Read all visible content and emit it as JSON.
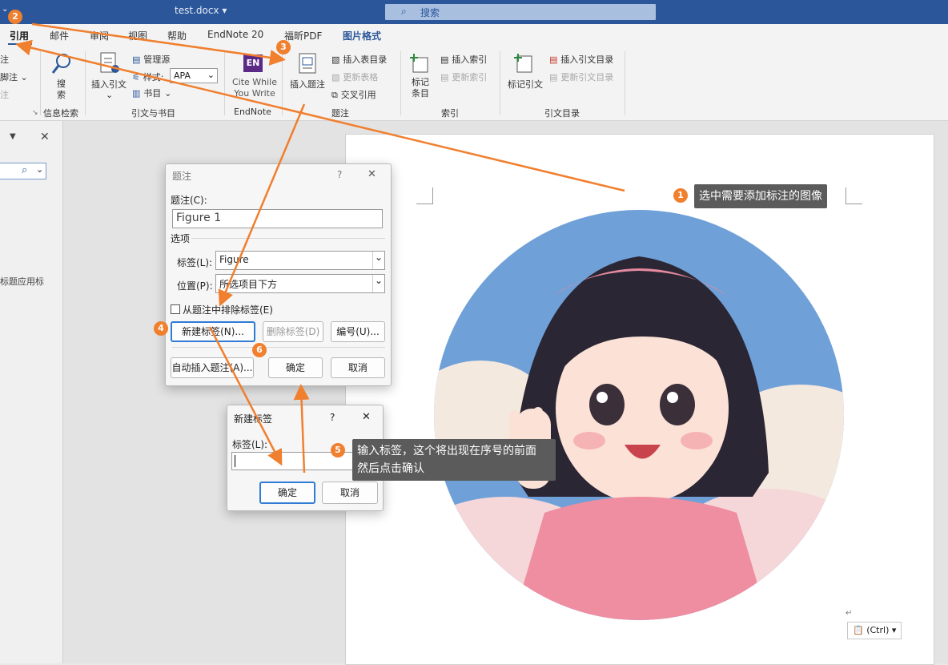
{
  "titlebar": {
    "doc_title": "test.docx ▾",
    "search_placeholder": "搜索"
  },
  "tabs": [
    "引用",
    "邮件",
    "审阅",
    "视图",
    "帮助",
    "EndNote 20",
    "福昕PDF",
    "图片格式"
  ],
  "ribbon": {
    "left_partial": [
      "注",
      "脚注 ⌄",
      "注"
    ],
    "search_btn": "搜\n索",
    "info_group": "信息检索",
    "insert_citation": "插入引文",
    "manage_source": "管理源",
    "style_label": "样式:",
    "style_value": "APA",
    "bibliography": "书目",
    "citation_group": "引文与书目",
    "cite_while_you_write": "Cite While You Write",
    "endnote_group": "EndNote",
    "insert_caption": "插入题注",
    "insert_table_of_figures": "插入表目录",
    "update_table": "更新表格",
    "cross_reference": "交叉引用",
    "caption_group": "题注",
    "mark_entry": "标记条目",
    "insert_index": "插入索引",
    "update_index": "更新索引",
    "index_group": "索引",
    "mark_citation": "标记引文",
    "insert_toa": "插入引文目录",
    "update_toa": "更新引文目录",
    "toa_group": "引文目录"
  },
  "navpane": {
    "partial_text": "标题应用标"
  },
  "caption_dialog": {
    "title": "题注",
    "help": "?",
    "close": "✕",
    "caption_label": "题注(C):",
    "caption_value": "Figure 1",
    "options_label": "选项",
    "label_label": "标签(L):",
    "label_value": "Figure",
    "position_label": "位置(P):",
    "position_value": "所选项目下方",
    "exclude_label": "从题注中排除标签(E)",
    "new_label_btn": "新建标签(N)...",
    "delete_label_btn": "删除标签(D)",
    "numbering_btn": "编号(U)...",
    "autocaption_btn": "自动插入题注(A)...",
    "ok_btn": "确定",
    "cancel_btn": "取消"
  },
  "newlabel_dialog": {
    "title": "新建标签",
    "help": "?",
    "close": "✕",
    "label_label": "标签(L):",
    "label_value": "",
    "ok_btn": "确定",
    "cancel_btn": "取消"
  },
  "annotations": {
    "step1": "选中需要添加标注的图像",
    "step5_line1": "输入标签，这个将出现在序号的前面",
    "step5_line2": "然后点击确认",
    "badges": [
      "1",
      "2",
      "3",
      "4",
      "5",
      "6"
    ]
  },
  "paste_options": "(Ctrl) ▾",
  "colors": {
    "titlebar": "#2b579a",
    "accent": "#f07f2e",
    "dialog_primary": "#2f7bd6"
  }
}
